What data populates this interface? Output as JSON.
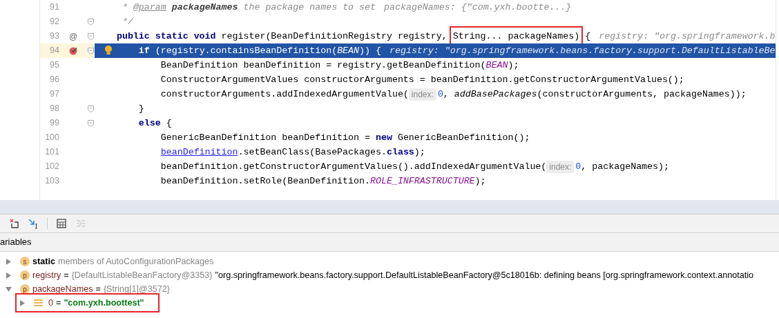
{
  "editor": {
    "lines": [
      {
        "number": "91",
        "breakpoint": false,
        "fold": false,
        "current": false,
        "tokens": [
          {
            "text": "     * ",
            "kind": "comment"
          },
          {
            "text": "@param",
            "kind": "doc_tag"
          },
          {
            "text": " packageNames",
            "kind": "doc_param"
          },
          {
            "text": " the package names to set",
            "kind": "comment"
          },
          {
            "text": "packageNames: {\"com.yxh.bootte...}",
            "kind": "inline_value"
          }
        ]
      },
      {
        "number": "92",
        "breakpoint": false,
        "fold": true,
        "current": false,
        "tokens": [
          {
            "text": "     */",
            "kind": "comment"
          }
        ]
      },
      {
        "number": "93",
        "gutter_text": "@",
        "breakpoint": false,
        "fold": true,
        "current": false,
        "tokens": [
          {
            "text": "    public static void",
            "kind": "keyword"
          },
          {
            "text": " register(BeanDefinitionRegistry registry, ",
            "kind": "plain"
          },
          {
            "text": "String... packageNames)",
            "kind": "plain",
            "boxed": true
          },
          {
            "text": " {",
            "kind": "plain"
          },
          {
            "text": "registry: \"org.springframework.b",
            "kind": "inline_value"
          }
        ]
      },
      {
        "number": "94",
        "breakpoint": true,
        "fold": true,
        "current": true,
        "tokens": [
          {
            "text": "        if",
            "kind": "keyword"
          },
          {
            "text": " (registry.containsBeanDefinition(",
            "kind": "plain"
          },
          {
            "text": "BEAN",
            "kind": "constant"
          },
          {
            "text": ")) {",
            "kind": "plain"
          },
          {
            "text": "registry: \"org.springframework.beans.factory.support.DefaultListableBe",
            "kind": "inline_value"
          }
        ]
      },
      {
        "number": "95",
        "breakpoint": false,
        "fold": false,
        "current": false,
        "tokens": [
          {
            "text": "            BeanDefinition beanDefinition = registry.getBeanDefinition(",
            "kind": "plain"
          },
          {
            "text": "BEAN",
            "kind": "constant"
          },
          {
            "text": ");",
            "kind": "plain"
          }
        ]
      },
      {
        "number": "96",
        "breakpoint": false,
        "fold": false,
        "current": false,
        "tokens": [
          {
            "text": "            ConstructorArgumentValues constructorArguments = beanDefinition.getConstructorArgumentValues();",
            "kind": "plain"
          }
        ]
      },
      {
        "number": "97",
        "breakpoint": false,
        "fold": false,
        "current": false,
        "tokens": [
          {
            "text": "            constructorArguments.addIndexedArgumentValue(",
            "kind": "plain"
          },
          {
            "text": "index:",
            "kind": "hint"
          },
          {
            "text": "0",
            "kind": "number"
          },
          {
            "text": ", ",
            "kind": "plain"
          },
          {
            "text": "addBasePackages",
            "kind": "static_method"
          },
          {
            "text": "(constructorArguments, packageNames));",
            "kind": "plain"
          }
        ]
      },
      {
        "number": "98",
        "breakpoint": false,
        "fold": true,
        "current": false,
        "tokens": [
          {
            "text": "        }",
            "kind": "plain"
          }
        ]
      },
      {
        "number": "99",
        "breakpoint": false,
        "fold": true,
        "current": false,
        "tokens": [
          {
            "text": "        else",
            "kind": "keyword"
          },
          {
            "text": " {",
            "kind": "plain"
          }
        ]
      },
      {
        "number": "100",
        "breakpoint": false,
        "fold": false,
        "current": false,
        "tokens": [
          {
            "text": "            GenericBeanDefinition beanDefinition = ",
            "kind": "plain"
          },
          {
            "text": "new",
            "kind": "keyword"
          },
          {
            "text": " GenericBeanDefinition();",
            "kind": "plain"
          }
        ]
      },
      {
        "number": "101",
        "breakpoint": false,
        "fold": false,
        "current": false,
        "tokens": [
          {
            "text": "            beanDefinition",
            "kind": "link"
          },
          {
            "text": ".setBeanClass(BasePackages.",
            "kind": "plain"
          },
          {
            "text": "class",
            "kind": "keyword"
          },
          {
            "text": ");",
            "kind": "plain"
          }
        ]
      },
      {
        "number": "102",
        "breakpoint": false,
        "fold": false,
        "current": false,
        "tokens": [
          {
            "text": "            beanDefinition.getConstructorArgumentValues().addIndexedArgumentValue(",
            "kind": "plain"
          },
          {
            "text": "index:",
            "kind": "hint"
          },
          {
            "text": "0",
            "kind": "number"
          },
          {
            "text": ", packageNames);",
            "kind": "plain"
          }
        ]
      },
      {
        "number": "103",
        "breakpoint": false,
        "fold": false,
        "current": false,
        "tokens": [
          {
            "text": "            beanDefinition.setRole(BeanDefinition.",
            "kind": "plain"
          },
          {
            "text": "ROLE_INFRASTRUCTURE",
            "kind": "constant"
          },
          {
            "text": ");",
            "kind": "plain"
          }
        ]
      }
    ]
  },
  "debugger": {
    "header": "ariables",
    "variables": [
      {
        "badge": "s",
        "expanded": false,
        "boxed": false,
        "kind": "static",
        "name": "static",
        "type": "members of AutoConfigurationPackages"
      },
      {
        "badge": "p",
        "expanded": false,
        "boxed": false,
        "kind": "field",
        "name": "registry",
        "equals": "=",
        "type": "{DefaultListableBeanFactory@3353}",
        "value": "\"org.springframework.beans.factory.support.DefaultListableBeanFactory@5c18016b: defining beans [org.springframework.context.annotatio"
      },
      {
        "badge": "p",
        "expanded": true,
        "boxed": false,
        "kind": "field",
        "name": "packageNames",
        "equals": "=",
        "type": "{String[1]@3572}",
        "children": [
          {
            "expanded": false,
            "boxed": true,
            "kind": "element",
            "name": "0",
            "equals": "=",
            "value": "\"com.yxh.boottest\""
          }
        ]
      }
    ]
  }
}
